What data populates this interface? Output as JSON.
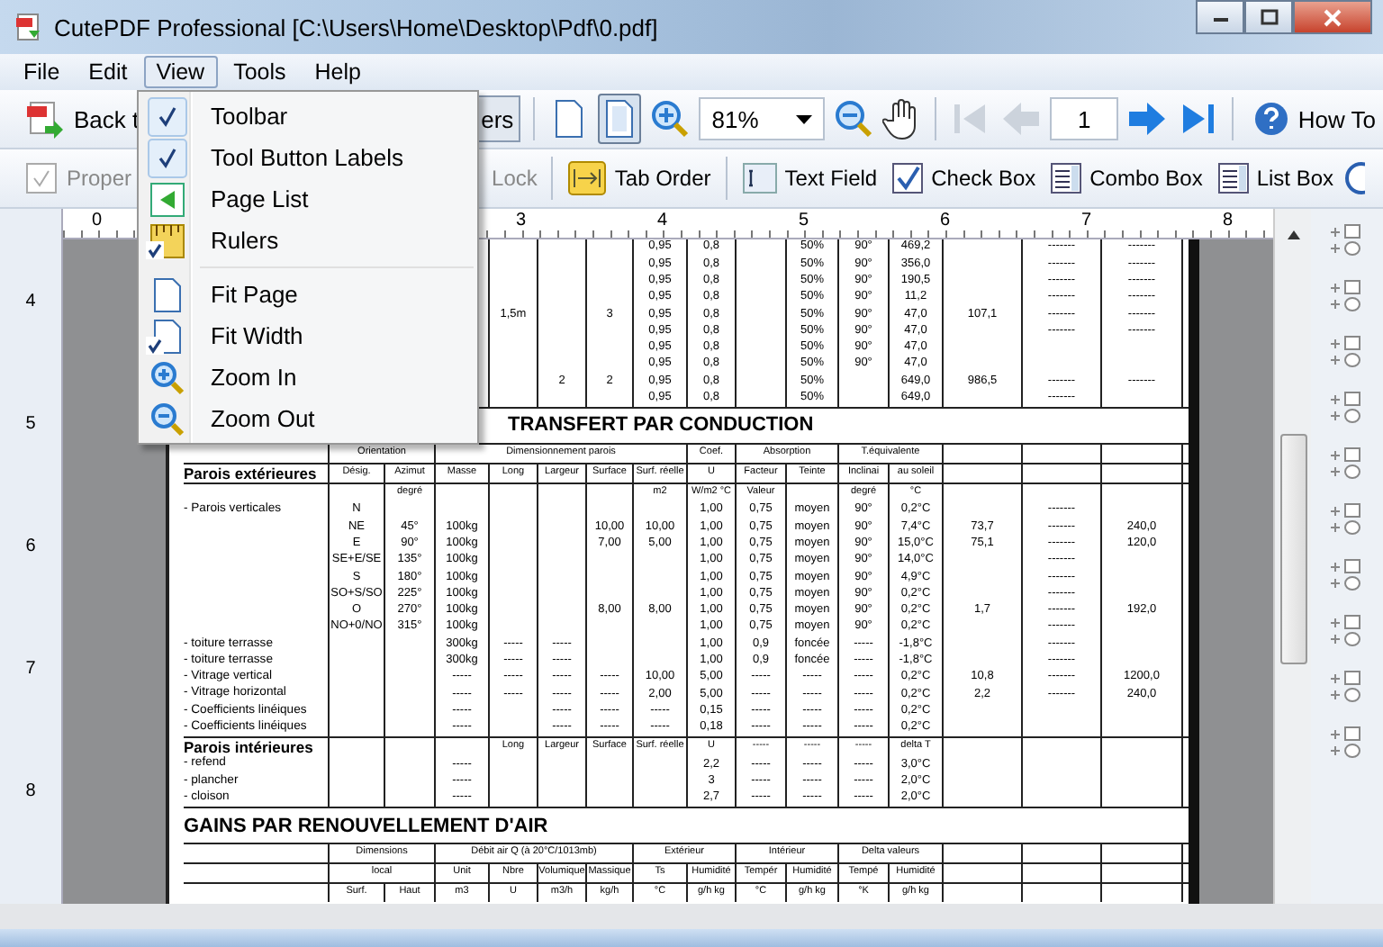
{
  "window": {
    "title": "CutePDF Professional [C:\\Users\\Home\\Desktop\\Pdf\\0.pdf]"
  },
  "menu_bar": [
    {
      "label": "File",
      "selected": false
    },
    {
      "label": "Edit",
      "selected": false
    },
    {
      "label": "View",
      "selected": true
    },
    {
      "label": "Tools",
      "selected": false
    },
    {
      "label": "Help",
      "selected": false
    }
  ],
  "view_menu": {
    "groups": [
      [
        {
          "kind": "plain",
          "label": "Toolbar",
          "checked": true
        },
        {
          "kind": "plain",
          "label": "Tool Button Labels",
          "checked": true
        },
        {
          "kind": "page-list",
          "label": "Page List",
          "checked": false
        },
        {
          "kind": "ruler",
          "label": "Rulers",
          "checked": true
        }
      ],
      [
        {
          "kind": "page",
          "label": "Fit Page",
          "checked": false
        },
        {
          "kind": "page-width",
          "label": "Fit Width",
          "checked": true
        },
        {
          "kind": "zoom-in",
          "label": "Zoom In",
          "checked": false
        },
        {
          "kind": "zoom-out",
          "label": "Zoom Out",
          "checked": false
        }
      ]
    ]
  },
  "toolbar": {
    "back_label": "Back t",
    "layers_label": "ers",
    "view_modes": [
      {
        "kind": "single",
        "selected": false
      },
      {
        "kind": "continuous",
        "selected": true
      }
    ],
    "zoom": "81%",
    "page": "1",
    "nav": [
      {
        "kind": "first",
        "disabled": true
      },
      {
        "kind": "prev",
        "disabled": true
      },
      {
        "kind": "next",
        "disabled": false
      },
      {
        "kind": "last",
        "disabled": false
      }
    ],
    "help_label": "How To"
  },
  "form_toolbar": [
    {
      "kind": "properties",
      "label": "Proper",
      "disabled": true
    },
    {
      "kind": "lock",
      "label": "Lock",
      "disabled": true
    },
    {
      "kind": "tab-order",
      "label": "Tab Order",
      "disabled": false
    },
    {
      "kind": "text-field",
      "label": "Text Field",
      "disabled": false
    },
    {
      "kind": "check-box",
      "label": "Check Box",
      "disabled": false
    },
    {
      "kind": "combo-box",
      "label": "Combo Box",
      "disabled": false
    },
    {
      "kind": "list-box",
      "label": "List Box",
      "disabled": false
    }
  ],
  "ruler": {
    "h_labels": [
      "0",
      "3",
      "4",
      "5",
      "6",
      "7",
      "8"
    ],
    "v_labels": [
      "4",
      "5",
      "6",
      "7",
      "8"
    ]
  },
  "document": {
    "rows": [
      {
        "kind": "data",
        "cells": [
          null,
          null,
          null,
          null,
          null,
          null,
          null,
          "0,95",
          "0,8",
          null,
          "50%",
          "90°",
          "469,2",
          null,
          "-------",
          "-------"
        ]
      },
      {
        "kind": "data",
        "cells": [
          null,
          null,
          null,
          null,
          null,
          null,
          null,
          "0,95",
          "0,8",
          null,
          "50%",
          "90°",
          "356,0",
          null,
          "-------",
          "-------"
        ]
      },
      {
        "kind": "data",
        "cells": [
          null,
          null,
          null,
          null,
          null,
          null,
          null,
          "0,95",
          "0,8",
          null,
          "50%",
          "90°",
          "190,5",
          null,
          "-------",
          "-------"
        ]
      },
      {
        "kind": "data",
        "cells": [
          null,
          null,
          null,
          null,
          null,
          null,
          null,
          "0,95",
          "0,8",
          null,
          "50%",
          "90°",
          "11,2",
          null,
          "-------",
          "-------"
        ]
      },
      {
        "kind": "data",
        "cells": [
          null,
          null,
          null,
          null,
          "1,5m",
          null,
          "3",
          "0,95",
          "0,8",
          null,
          "50%",
          "90°",
          "47,0",
          "107,1",
          "-------",
          "-------"
        ]
      },
      {
        "kind": "data",
        "cells": [
          null,
          null,
          null,
          null,
          null,
          null,
          null,
          "0,95",
          "0,8",
          null,
          "50%",
          "90°",
          "47,0",
          null,
          "-------",
          "-------"
        ]
      },
      {
        "kind": "data",
        "cells": [
          null,
          null,
          null,
          null,
          null,
          null,
          null,
          "0,95",
          "0,8",
          null,
          "50%",
          "90°",
          "47,0",
          null,
          null,
          null
        ]
      },
      {
        "kind": "data",
        "cells": [
          null,
          null,
          null,
          null,
          null,
          null,
          null,
          "0,95",
          "0,8",
          null,
          "50%",
          "90°",
          "47,0",
          null,
          null,
          null
        ]
      },
      {
        "kind": "data",
        "cells": [
          null,
          null,
          null,
          null,
          null,
          "2",
          "2",
          "0,95",
          "0,8",
          null,
          "50%",
          null,
          "649,0",
          "986,5",
          "-------",
          "-------"
        ]
      },
      {
        "kind": "data",
        "cells": [
          null,
          null,
          null,
          null,
          null,
          null,
          null,
          "0,95",
          "0,8",
          null,
          "50%",
          null,
          "649,0",
          null,
          "-------",
          null
        ]
      },
      {
        "kind": "title",
        "cells": [
          "TRANSFERT PAR CONDUCTION"
        ]
      },
      {
        "kind": "group_header",
        "cells": [
          null,
          "Orientation",
          null,
          "Dimensionnement parois",
          null,
          null,
          null,
          null,
          "Coef.",
          "Absorption",
          null,
          "T.équivalente",
          null,
          null,
          null,
          null
        ]
      },
      {
        "kind": "header",
        "cells": [
          "Parois extérieures",
          "Désig.",
          "Azimut",
          "Masse",
          "Long",
          "Largeur",
          "Surface",
          "Surf. réelle",
          "U",
          "Facteur",
          "Teinte",
          "Inclinai",
          "au soleil",
          null,
          null,
          null
        ]
      },
      {
        "kind": "header",
        "cells": [
          null,
          null,
          "degré",
          null,
          null,
          null,
          null,
          "m2",
          "W/m2 °C",
          "Valeur",
          null,
          "degré",
          "°C",
          null,
          null,
          null
        ]
      },
      {
        "kind": "data",
        "cells": [
          "- Parois verticales",
          "N",
          null,
          null,
          null,
          null,
          null,
          null,
          "1,00",
          "0,75",
          "moyen",
          "90°",
          "0,2°C",
          null,
          "-------",
          null
        ]
      },
      {
        "kind": "data",
        "cells": [
          null,
          "NE",
          "45°",
          "100kg",
          null,
          null,
          "10,00",
          "10,00",
          "1,00",
          "0,75",
          "moyen",
          "90°",
          "7,4°C",
          "73,7",
          "-------",
          "240,0"
        ]
      },
      {
        "kind": "data",
        "cells": [
          null,
          "E",
          "90°",
          "100kg",
          null,
          null,
          "7,00",
          "5,00",
          "1,00",
          "0,75",
          "moyen",
          "90°",
          "15,0°C",
          "75,1",
          "-------",
          "120,0"
        ]
      },
      {
        "kind": "data",
        "cells": [
          null,
          "SE+E/SE",
          "135°",
          "100kg",
          null,
          null,
          null,
          null,
          "1,00",
          "0,75",
          "moyen",
          "90°",
          "14,0°C",
          null,
          "-------",
          null
        ]
      },
      {
        "kind": "data",
        "cells": [
          null,
          "S",
          "180°",
          "100kg",
          null,
          null,
          null,
          null,
          "1,00",
          "0,75",
          "moyen",
          "90°",
          "4,9°C",
          null,
          "-------",
          null
        ]
      },
      {
        "kind": "data",
        "cells": [
          null,
          "SO+S/SO",
          "225°",
          "100kg",
          null,
          null,
          null,
          null,
          "1,00",
          "0,75",
          "moyen",
          "90°",
          "0,2°C",
          null,
          "-------",
          null
        ]
      },
      {
        "kind": "data",
        "cells": [
          null,
          "O",
          "270°",
          "100kg",
          null,
          null,
          "8,00",
          "8,00",
          "1,00",
          "0,75",
          "moyen",
          "90°",
          "0,2°C",
          "1,7",
          "-------",
          "192,0"
        ]
      },
      {
        "kind": "data",
        "cells": [
          null,
          "NO+0/NO",
          "315°",
          "100kg",
          null,
          null,
          null,
          null,
          "1,00",
          "0,75",
          "moyen",
          "90°",
          "0,2°C",
          null,
          "-------",
          null
        ]
      },
      {
        "kind": "data",
        "cells": [
          "- toiture terrasse",
          null,
          null,
          "300kg",
          "-----",
          "-----",
          null,
          null,
          "1,00",
          "0,9",
          "foncée",
          "-----",
          "-1,8°C",
          null,
          "-------",
          null
        ]
      },
      {
        "kind": "data",
        "cells": [
          "- toiture terrasse",
          null,
          null,
          "300kg",
          "-----",
          "-----",
          null,
          null,
          "1,00",
          "0,9",
          "foncée",
          "-----",
          "-1,8°C",
          null,
          "-------",
          null
        ]
      },
      {
        "kind": "data",
        "cells": [
          "- Vitrage vertical",
          null,
          null,
          "-----",
          "-----",
          "-----",
          "-----",
          "10,00",
          "5,00",
          "-----",
          "-----",
          "-----",
          "0,2°C",
          "10,8",
          "-------",
          "1200,0"
        ]
      },
      {
        "kind": "data",
        "cells": [
          "- Vitrage horizontal",
          null,
          null,
          "-----",
          "-----",
          "-----",
          "-----",
          "2,00",
          "5,00",
          "-----",
          "-----",
          "-----",
          "0,2°C",
          "2,2",
          "-------",
          "240,0"
        ]
      },
      {
        "kind": "data",
        "cells": [
          "- Coefficients linéiques",
          null,
          null,
          "-----",
          null,
          "-----",
          "-----",
          "-----",
          "0,15",
          "-----",
          "-----",
          "-----",
          "0,2°C",
          null,
          null,
          null
        ]
      },
      {
        "kind": "data",
        "cells": [
          "- Coefficients linéiques",
          null,
          null,
          "-----",
          null,
          "-----",
          "-----",
          "-----",
          "0,18",
          "-----",
          "-----",
          "-----",
          "0,2°C",
          null,
          null,
          null
        ]
      },
      {
        "kind": "header",
        "cells": [
          "Parois intérieures",
          null,
          null,
          null,
          "Long",
          "Largeur",
          "Surface",
          "Surf. réelle",
          "U",
          "-----",
          "-----",
          "-----",
          "delta T",
          null,
          null,
          null
        ]
      },
      {
        "kind": "data",
        "cells": [
          "- refend",
          null,
          null,
          "-----",
          null,
          null,
          null,
          null,
          "2,2",
          "-----",
          "-----",
          "-----",
          "3,0°C",
          null,
          null,
          null
        ]
      },
      {
        "kind": "data",
        "cells": [
          "- plancher",
          null,
          null,
          "-----",
          null,
          null,
          null,
          null,
          "3",
          "-----",
          "-----",
          "-----",
          "2,0°C",
          null,
          null,
          null
        ]
      },
      {
        "kind": "data",
        "cells": [
          "- cloison",
          null,
          null,
          "-----",
          null,
          null,
          null,
          null,
          "2,7",
          "-----",
          "-----",
          "-----",
          "2,0°C",
          null,
          null,
          null
        ]
      },
      {
        "kind": "section",
        "cells": [
          "GAINS PAR RENOUVELLEMENT D'AIR"
        ]
      },
      {
        "kind": "group_header",
        "cells": [
          null,
          "Dimensions",
          null,
          "Débit air Q (à 20°C/1013mb)",
          null,
          null,
          null,
          "Extérieur",
          null,
          "Intérieur",
          null,
          "Delta valeurs",
          null,
          null,
          null,
          null
        ]
      },
      {
        "kind": "group_header",
        "cells": [
          null,
          "local",
          null,
          "Unit",
          "Nbre",
          "Volumique",
          "Massique",
          "Ts",
          "Humidité",
          "Tempér",
          "Humidité",
          "Tempé",
          "Humidité",
          null,
          null,
          null
        ]
      },
      {
        "kind": "header",
        "cells": [
          null,
          "Surf.",
          "Haut",
          "m3",
          "U",
          "m3/h",
          "kg/h",
          "°C",
          "g/h kg",
          "°C",
          "g/h kg",
          "°K",
          "g/h kg",
          null,
          null,
          null
        ]
      }
    ]
  }
}
